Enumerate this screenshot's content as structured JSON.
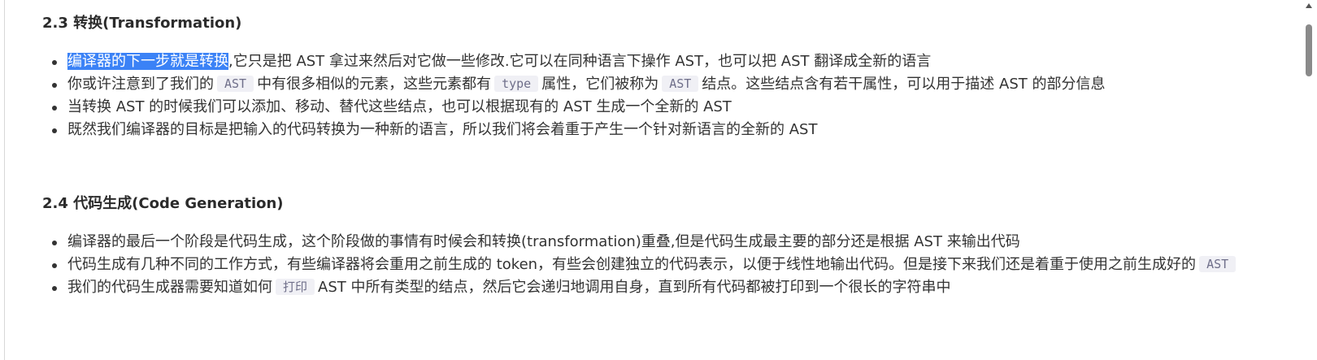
{
  "section_23": {
    "heading": "2.3 转换(Transformation)",
    "bullets": [
      {
        "highlight": "编译器的下一步就是转换",
        "text": ",它只是把 AST 拿过来然后对它做一些修改.它可以在同种语言下操作 AST，也可以把 AST 翻译成全新的语言"
      },
      {
        "t1": "你或许注意到了我们的",
        "c1": "AST",
        "t2": "中有很多相似的元素，这些元素都有",
        "c2": "type",
        "t3": "属性，它们被称为",
        "c3": "AST",
        "t4": "结点。这些结点含有若干属性，可以用于描述 AST 的部分信息"
      },
      {
        "text": "当转换 AST 的时候我们可以添加、移动、替代这些结点，也可以根据现有的 AST 生成一个全新的 AST"
      },
      {
        "text": "既然我们编译器的目标是把输入的代码转换为一种新的语言，所以我们将会着重于产生一个针对新语言的全新的 AST"
      }
    ]
  },
  "section_24": {
    "heading": "2.4 代码生成(Code Generation)",
    "bullets": [
      {
        "text": "编译器的最后一个阶段是代码生成，这个阶段做的事情有时候会和转换(transformation)重叠,但是代码生成最主要的部分还是根据 AST 来输出代码"
      },
      {
        "t1": "代码生成有几种不同的工作方式，有些编译器将会重用之前生成的 token，有些会创建独立的代码表示，以便于线性地输出代码。但是接下来我们还是着重于使用之前生成好的",
        "c1": "AST"
      },
      {
        "t1": "我们的代码生成器需要知道如何",
        "c1": "打印",
        "t2": "AST 中所有类型的结点，然后它会递归地调用自身，直到所有代码都被打印到一个很长的字符串中"
      }
    ]
  },
  "colors": {
    "selection": "#3b82f6",
    "inline_code_bg": "#f0f0f5",
    "text": "#333333"
  }
}
